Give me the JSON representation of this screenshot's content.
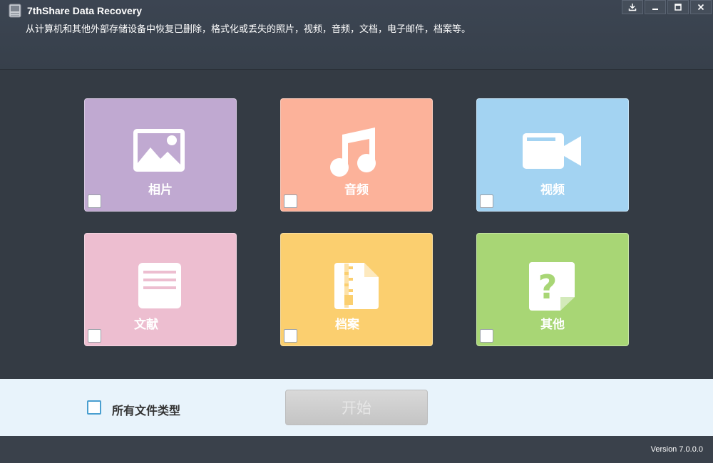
{
  "window": {
    "title": "7thShare Data Recovery",
    "subtitle": "从计算机和其他外部存储设备中恢复已删除，格式化或丢失的照片，视频，音频，文档，电子邮件，档案等。",
    "controls": [
      "download-icon",
      "minimize-icon",
      "maximize-icon",
      "close-icon"
    ]
  },
  "categories": [
    {
      "id": "photo",
      "label": "相片",
      "color": "#c0a9d1",
      "icon": "image-icon"
    },
    {
      "id": "audio",
      "label": "音频",
      "color": "#fcb29a",
      "icon": "music-note-icon"
    },
    {
      "id": "video",
      "label": "视频",
      "color": "#a3d3f2",
      "icon": "video-camera-icon"
    },
    {
      "id": "document",
      "label": "文献",
      "color": "#edbed0",
      "icon": "document-icon"
    },
    {
      "id": "archive",
      "label": "档案",
      "color": "#fbcf6f",
      "icon": "zip-file-icon"
    },
    {
      "id": "other",
      "label": "其他",
      "color": "#a8d675",
      "icon": "question-file-icon"
    }
  ],
  "footer": {
    "all_types_label": "所有文件类型",
    "start_label": "开始"
  },
  "status": {
    "version": "Version 7.0.0.0"
  }
}
